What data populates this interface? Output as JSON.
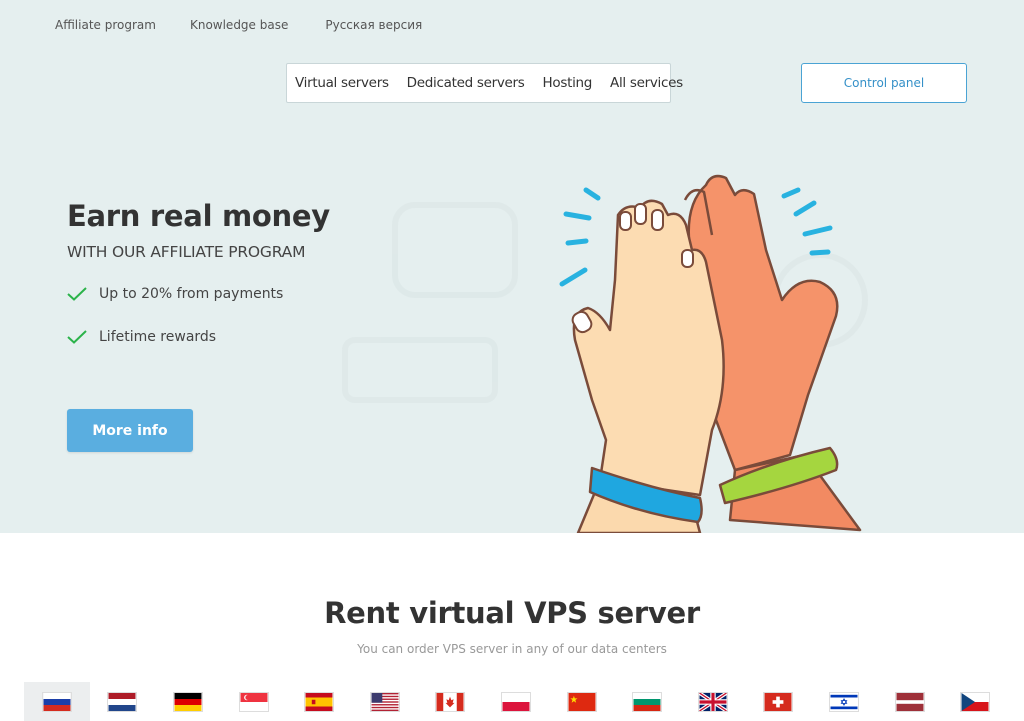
{
  "top_links": [
    "Affiliate program",
    "Knowledge base",
    "Русская версия"
  ],
  "nav": [
    "Virtual servers",
    "Dedicated servers",
    "Hosting",
    "All services"
  ],
  "control_panel_label": "Control panel",
  "hero": {
    "title": "Earn real money",
    "subtitle": "WITH OUR AFFILIATE PROGRAM",
    "bullets": [
      "Up to 20% from payments",
      "Lifetime rewards"
    ],
    "button_label": "More info"
  },
  "section": {
    "title": "Rent virtual VPS server",
    "subtitle": "You can order VPS server in any of our data centers"
  },
  "colors": {
    "hero_bg": "#e5efef",
    "accent": "#5aaee0",
    "check": "#2bb34a"
  },
  "flags": [
    {
      "country": "russia",
      "active": true
    },
    {
      "country": "netherlands",
      "active": false
    },
    {
      "country": "germany",
      "active": false
    },
    {
      "country": "singapore",
      "active": false
    },
    {
      "country": "spain",
      "active": false
    },
    {
      "country": "usa",
      "active": false
    },
    {
      "country": "canada",
      "active": false
    },
    {
      "country": "poland",
      "active": false
    },
    {
      "country": "china",
      "active": false
    },
    {
      "country": "bulgaria",
      "active": false
    },
    {
      "country": "uk",
      "active": false
    },
    {
      "country": "switzerland",
      "active": false
    },
    {
      "country": "israel",
      "active": false
    },
    {
      "country": "latvia",
      "active": false
    },
    {
      "country": "czech",
      "active": false
    }
  ]
}
